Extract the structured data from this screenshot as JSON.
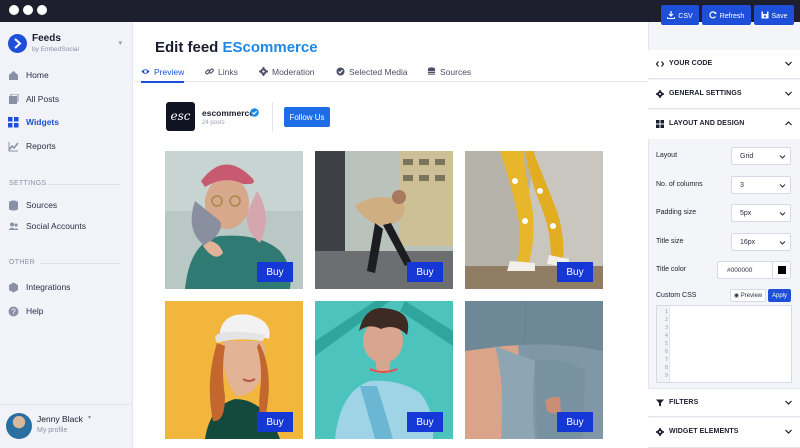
{
  "window": {
    "dots": 3
  },
  "sidebar": {
    "brand": {
      "name": "Feeds",
      "sub": "by EmbedSocial"
    },
    "items": [
      {
        "label": "Home",
        "icon": "home-icon"
      },
      {
        "label": "All Posts",
        "icon": "posts-icon"
      },
      {
        "label": "Widgets",
        "icon": "widgets-icon",
        "active": true
      },
      {
        "label": "Reports",
        "icon": "reports-icon"
      }
    ],
    "settings_label": "SETTINGS",
    "settings_items": [
      {
        "label": "Sources",
        "icon": "sources-icon"
      },
      {
        "label": "Social Accounts",
        "icon": "users-icon"
      }
    ],
    "other_label": "OTHER",
    "other_items": [
      {
        "label": "Integrations",
        "icon": "cube-icon"
      },
      {
        "label": "Help",
        "icon": "help-icon"
      }
    ],
    "profile": {
      "name": "Jenny Black",
      "sub": "My profile"
    }
  },
  "main": {
    "title_prefix": "Edit feed",
    "title_accent": "EScommerce",
    "tabs": [
      {
        "label": "Preview",
        "icon": "eye-icon",
        "active": true
      },
      {
        "label": "Links",
        "icon": "link-icon"
      },
      {
        "label": "Moderation",
        "icon": "gear-icon"
      },
      {
        "label": "Selected Media",
        "icon": "check-circle-icon"
      },
      {
        "label": "Sources",
        "icon": "database-icon"
      }
    ],
    "account": {
      "logo": "esc",
      "name": "escommerce",
      "posts": "24 posts",
      "follow_label": "Follow Us"
    },
    "buy_label": "Buy",
    "tiles": 6
  },
  "panel": {
    "buttons": {
      "csv": "CSV",
      "refresh": "Refresh",
      "save": "Save"
    },
    "sections": {
      "your_code": "YOUR CODE",
      "general": "GENERAL SETTINGS",
      "layout": "LAYOUT AND DESIGN",
      "filters": "FILTERS",
      "widget_elements": "WIDGET ELEMENTS"
    },
    "layout": {
      "layout_label": "Layout",
      "layout_value": "Grid",
      "columns_label": "No. of columns",
      "columns_value": "3",
      "padding_label": "Padding size",
      "padding_value": "5px",
      "title_size_label": "Title size",
      "title_size_value": "16px",
      "title_color_label": "Title color",
      "title_color_value": "#000000",
      "custom_css_label": "Custom CSS",
      "preview_label": "Preview",
      "apply_label": "Apply"
    },
    "editor_lines": [
      "1",
      "2",
      "3",
      "4",
      "5",
      "6",
      "7",
      "8",
      "9"
    ]
  }
}
